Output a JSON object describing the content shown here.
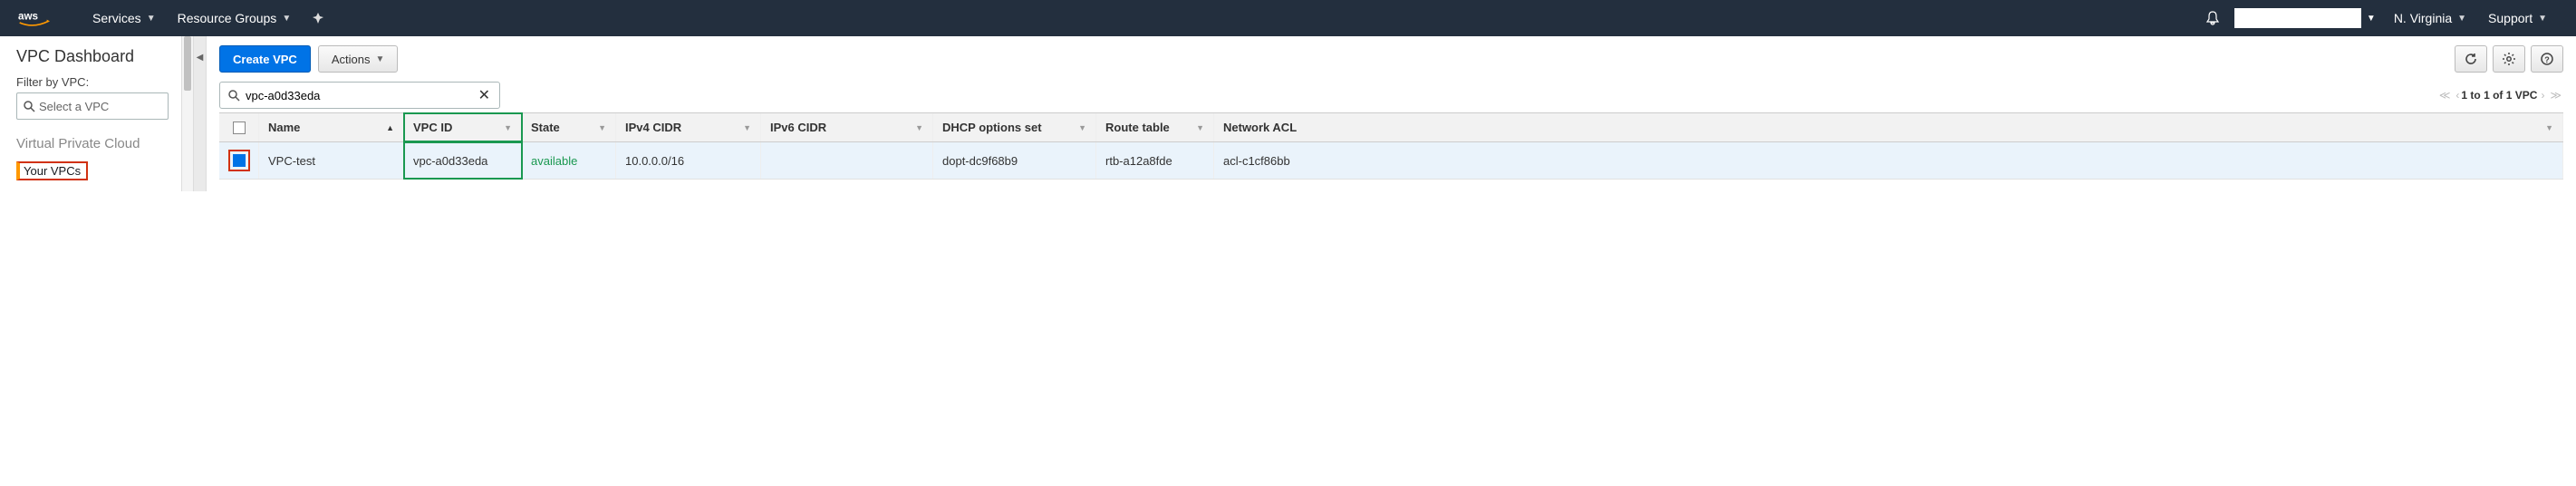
{
  "topnav": {
    "services": "Services",
    "resource_groups": "Resource Groups",
    "region": "N. Virginia",
    "support": "Support"
  },
  "sidebar": {
    "title": "VPC Dashboard",
    "filter_label": "Filter by VPC:",
    "filter_placeholder": "Select a VPC",
    "section": "Virtual Private Cloud",
    "link_your_vpcs": "Your VPCs"
  },
  "toolbar": {
    "create": "Create VPC",
    "actions": "Actions"
  },
  "search": {
    "value": "vpc-a0d33eda"
  },
  "pager": {
    "text_prefix": "1 to 1 of 1 VPC"
  },
  "columns": {
    "name": "Name",
    "vpc_id": "VPC ID",
    "state": "State",
    "ipv4": "IPv4 CIDR",
    "ipv6": "IPv6 CIDR",
    "dhcp": "DHCP options set",
    "rt": "Route table",
    "acl": "Network ACL"
  },
  "rows": [
    {
      "name": "VPC-test",
      "vpc_id": "vpc-a0d33eda",
      "state": "available",
      "ipv4": "10.0.0.0/16",
      "ipv6": "",
      "dhcp": "dopt-dc9f68b9",
      "rt": "rtb-a12a8fde",
      "acl": "acl-c1cf86bb"
    }
  ]
}
